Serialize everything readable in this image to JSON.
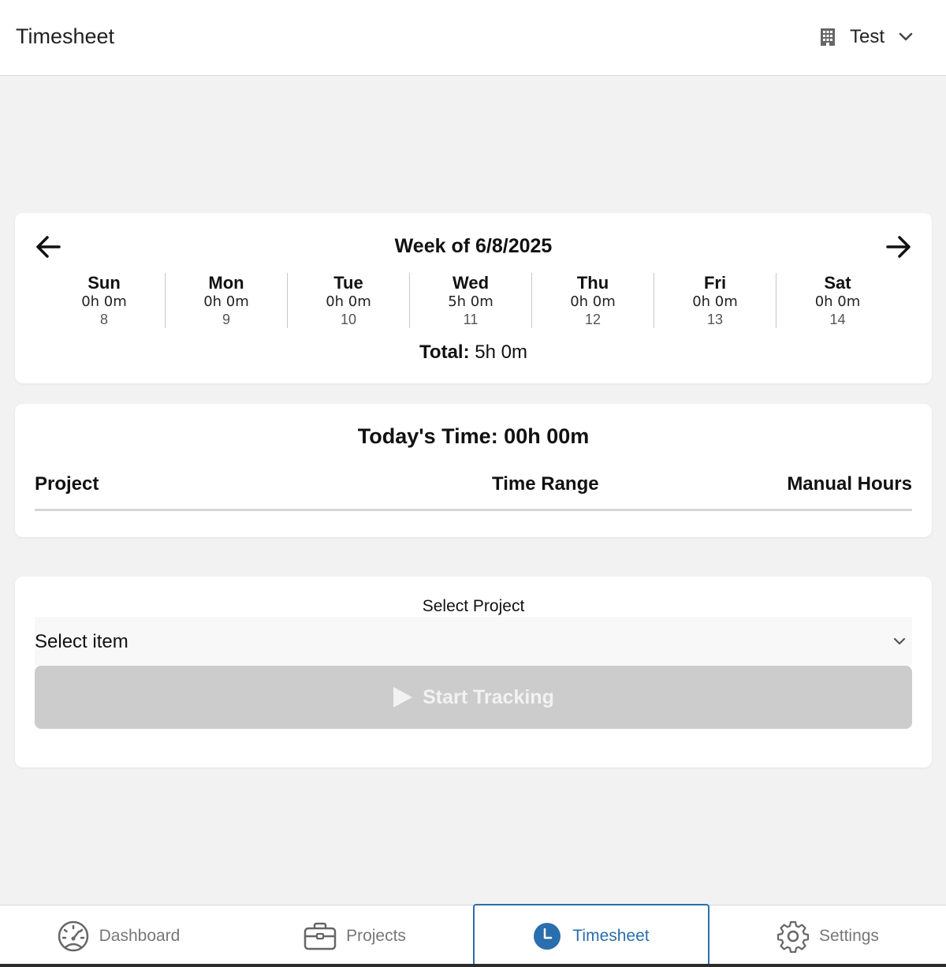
{
  "header": {
    "title": "Timesheet",
    "org_name": "Test",
    "org_icon": "building-icon"
  },
  "week": {
    "title": "Week of 6/8/2025",
    "days": [
      {
        "name": "Sun",
        "hours": "0h 0m",
        "date": "8"
      },
      {
        "name": "Mon",
        "hours": "0h 0m",
        "date": "9"
      },
      {
        "name": "Tue",
        "hours": "0h 0m",
        "date": "10"
      },
      {
        "name": "Wed",
        "hours": "5h 0m",
        "date": "11"
      },
      {
        "name": "Thu",
        "hours": "0h 0m",
        "date": "12"
      },
      {
        "name": "Fri",
        "hours": "0h 0m",
        "date": "13"
      },
      {
        "name": "Sat",
        "hours": "0h 0m",
        "date": "14"
      }
    ],
    "total_label": "Total:",
    "total_value": "5h 0m"
  },
  "today": {
    "title": "Today's Time: 00h 00m",
    "columns": [
      "Project",
      "Time Range",
      "Manual Hours"
    ]
  },
  "tracker": {
    "select_label": "Select Project",
    "select_value": "Select item",
    "start_label": "Start Tracking"
  },
  "tabs": [
    {
      "label": "Dashboard",
      "icon": "dashboard-icon",
      "active": false
    },
    {
      "label": "Projects",
      "icon": "briefcase-icon",
      "active": false
    },
    {
      "label": "Timesheet",
      "icon": "clock-icon",
      "active": true
    },
    {
      "label": "Settings",
      "icon": "gear-icon",
      "active": false
    }
  ],
  "colors": {
    "accent": "#2a6fad",
    "background": "#f2f2f2",
    "disabled_button": "#cccccc"
  }
}
